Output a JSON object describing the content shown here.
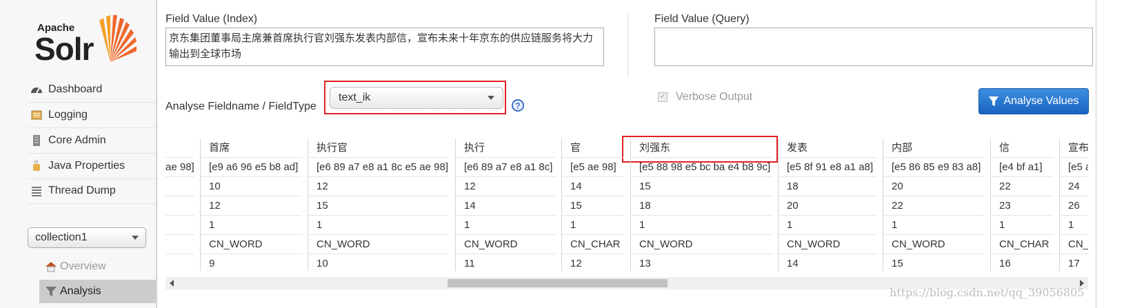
{
  "logo": {
    "apache": "Apache",
    "solr": "Solr"
  },
  "sidebar": {
    "items": [
      {
        "label": "Dashboard",
        "icon": "dashboard-icon"
      },
      {
        "label": "Logging",
        "icon": "logging-icon"
      },
      {
        "label": "Core Admin",
        "icon": "core-admin-icon"
      },
      {
        "label": "Java Properties",
        "icon": "java-icon"
      },
      {
        "label": "Thread Dump",
        "icon": "thread-dump-icon"
      }
    ],
    "core_selector": "collection1",
    "sub_items": [
      {
        "label": "Overview",
        "icon": "home-icon"
      },
      {
        "label": "Analysis",
        "icon": "filter-icon"
      }
    ]
  },
  "form": {
    "index_label": "Field Value (Index)",
    "index_value": "京东集团董事局主席兼首席执行官刘强东发表内部信，宣布未来十年京东的供应链服务将大力输出到全球市场",
    "query_label": "Field Value (Query)",
    "query_value": "",
    "fieldtype_label": "Analyse Fieldname / FieldType",
    "fieldtype_value": "text_ik",
    "help": "?",
    "verbose_label": "Verbose Output",
    "analyse_button": "Analyse Values"
  },
  "tokens": [
    {
      "text": "",
      "raw": "ae 98]",
      "start": "",
      "end": "",
      "position": "",
      "type": "",
      "pos": ""
    },
    {
      "text": "首席",
      "raw": "[e9 a6 96 e5 b8 ad]",
      "start": "10",
      "end": "12",
      "position": "1",
      "type": "CN_WORD",
      "pos": "9"
    },
    {
      "text": "执行官",
      "raw": "[e6 89 a7 e8 a1 8c e5 ae 98]",
      "start": "12",
      "end": "15",
      "position": "1",
      "type": "CN_WORD",
      "pos": "10"
    },
    {
      "text": "执行",
      "raw": "[e6 89 a7 e8 a1 8c]",
      "start": "12",
      "end": "14",
      "position": "1",
      "type": "CN_WORD",
      "pos": "11"
    },
    {
      "text": "官",
      "raw": "[e5 ae 98]",
      "start": "14",
      "end": "15",
      "position": "1",
      "type": "CN_CHAR",
      "pos": "12"
    },
    {
      "text": "刘强东",
      "raw": "[e5 88 98 e5 bc ba e4 b8 9c]",
      "start": "15",
      "end": "18",
      "position": "1",
      "type": "CN_WORD",
      "pos": "13"
    },
    {
      "text": "发表",
      "raw": "[e5 8f 91 e8 a1 a8]",
      "start": "18",
      "end": "20",
      "position": "1",
      "type": "CN_WORD",
      "pos": "14"
    },
    {
      "text": "内部",
      "raw": "[e5 86 85 e9 83 a8]",
      "start": "20",
      "end": "22",
      "position": "1",
      "type": "CN_WORD",
      "pos": "15"
    },
    {
      "text": "信",
      "raw": "[e4 bf a1]",
      "start": "22",
      "end": "23",
      "position": "1",
      "type": "CN_CHAR",
      "pos": "16"
    },
    {
      "text": "宣布",
      "raw": "[e5 a",
      "start": "24",
      "end": "26",
      "position": "1",
      "type": "CN_",
      "pos": "17"
    }
  ],
  "watermark": "https://blog.csdn.net/qq_39056805",
  "colors": {
    "accent": "#2a78d2",
    "highlight": "#e02020",
    "sidebar_active": "#cccccc"
  }
}
